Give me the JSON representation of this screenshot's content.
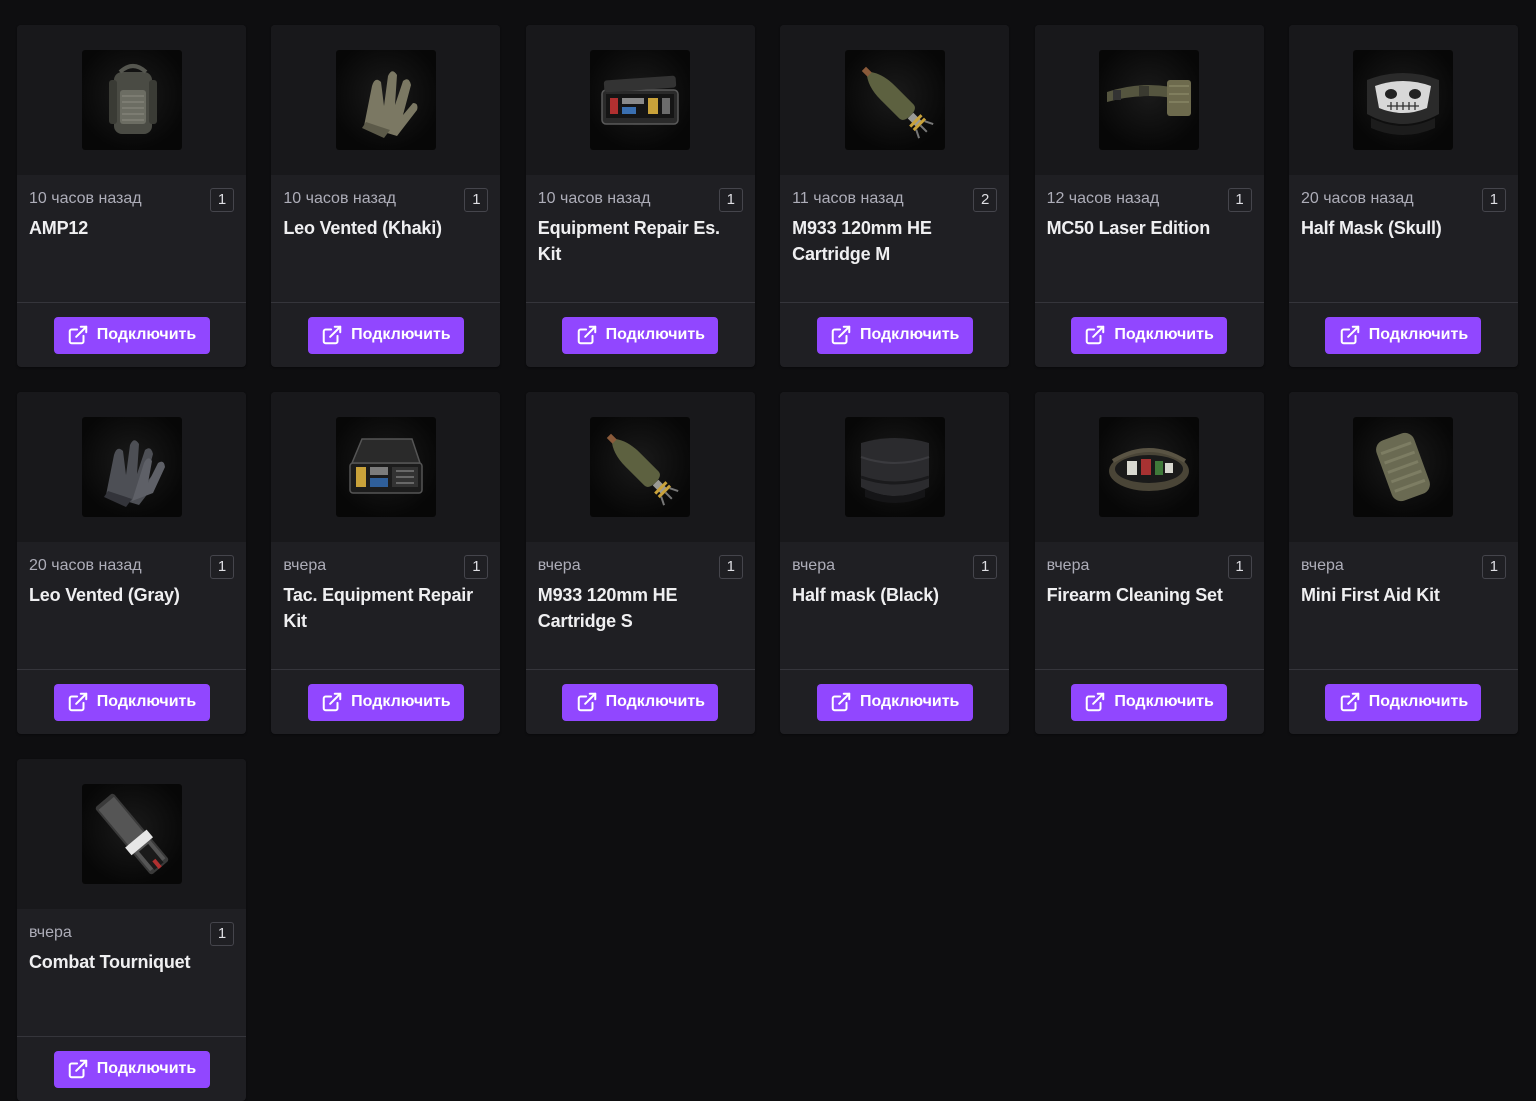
{
  "connect_label": "Подключить",
  "icons": {
    "button_icon": "external-link-icon"
  },
  "colors": {
    "page_bg": "#0e0e10",
    "card_bg": "#1f1f23",
    "thumb_bg": "#18181b",
    "accent": "#9147ff",
    "time_text": "#adadb8",
    "title_text": "#efeff1"
  },
  "items": [
    {
      "time": "10 часов назад",
      "count": "1",
      "title": "AMP12",
      "image": "backpack-image"
    },
    {
      "time": "10 часов назад",
      "count": "1",
      "title": "Leo Vented (Khaki)",
      "image": "gloves-khaki-image"
    },
    {
      "time": "10 часов назад",
      "count": "1",
      "title": "Equipment Repair Es. Kit",
      "image": "repair-kit-image"
    },
    {
      "time": "11 часов назад",
      "count": "2",
      "title": "M933 120mm HE Cartridge M",
      "image": "mortar-shell-image"
    },
    {
      "time": "12 часов назад",
      "count": "1",
      "title": "MC50 Laser Edition",
      "image": "belt-image"
    },
    {
      "time": "20 часов назад",
      "count": "1",
      "title": "Half Mask (Skull)",
      "image": "skull-mask-image"
    },
    {
      "time": "20 часов назад",
      "count": "1",
      "title": "Leo Vented (Gray)",
      "image": "gloves-gray-image"
    },
    {
      "time": "вчера",
      "count": "1",
      "title": "Tac. Equipment Repair Kit",
      "image": "tac-repair-kit-image"
    },
    {
      "time": "вчера",
      "count": "1",
      "title": "M933 120mm HE Cartridge S",
      "image": "mortar-shell-image"
    },
    {
      "time": "вчера",
      "count": "1",
      "title": "Half mask (Black)",
      "image": "black-mask-image"
    },
    {
      "time": "вчера",
      "count": "1",
      "title": "Firearm Cleaning Set",
      "image": "cleaning-set-image"
    },
    {
      "time": "вчера",
      "count": "1",
      "title": "Mini First Aid Kit",
      "image": "first-aid-pouch-image"
    },
    {
      "time": "вчера",
      "count": "1",
      "title": "Combat Tourniquet",
      "image": "tourniquet-image"
    }
  ]
}
